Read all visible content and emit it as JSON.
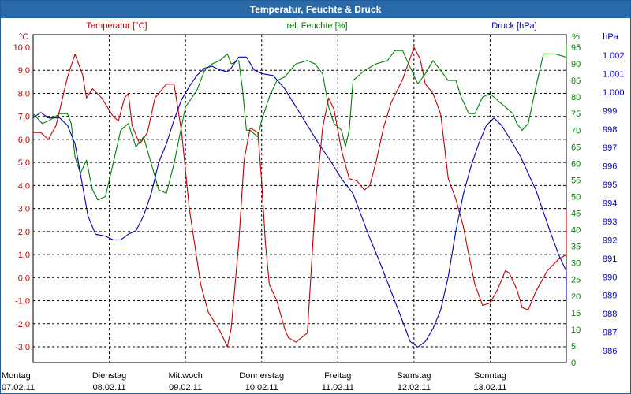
{
  "title": "Temperatur, Feuchte & Druck",
  "colors": {
    "temperature": "#c00000",
    "humidity": "#008000",
    "pressure": "#0000b4",
    "titlebar": "#2a6aa8",
    "grid": "#000000"
  },
  "chart_data": {
    "type": "line",
    "title": "Temperatur, Feuchte & Druck",
    "x_labels": [
      {
        "day": "Montag",
        "date": "07.02.11"
      },
      {
        "day": "Dienstag",
        "date": "08.02.11"
      },
      {
        "day": "Mittwoch",
        "date": "09.02.11"
      },
      {
        "day": "Donnerstag",
        "date": "10.02.11"
      },
      {
        "day": "Freitag",
        "date": "11.02.11"
      },
      {
        "day": "Samstag",
        "date": "12.02.11"
      },
      {
        "day": "Sonntag",
        "date": "13.02.11"
      }
    ],
    "x_range_days": [
      0,
      7
    ],
    "grid": true,
    "axes": {
      "temperature": {
        "unit": "°C",
        "label": "Temperatur [°C]",
        "range": [
          -3.0,
          10.0
        ],
        "ticks": [
          "10,0",
          "9,0",
          "8,0",
          "7,0",
          "6,0",
          "5,0",
          "4,0",
          "3,0",
          "2,0",
          "1,0",
          "0,0",
          "-1,0",
          "-2,0",
          "-3,0"
        ]
      },
      "humidity": {
        "unit": "%",
        "label": "rel. Feuchte [%]",
        "range": [
          0,
          95
        ],
        "ticks": [
          "95",
          "90",
          "85",
          "80",
          "75",
          "70",
          "65",
          "60",
          "55",
          "50",
          "45",
          "40",
          "35",
          "30",
          "25",
          "20",
          "15",
          "10",
          "5",
          "0"
        ]
      },
      "pressure": {
        "unit": "hPa",
        "label": "Druck [hPa]",
        "range": [
          986,
          1002
        ],
        "ticks": [
          "1.002",
          "1.001",
          "1.000",
          "999",
          "998",
          "997",
          "996",
          "995",
          "994",
          "993",
          "992",
          "991",
          "990",
          "989",
          "988",
          "987",
          "986"
        ]
      }
    },
    "series": [
      {
        "name": "Temperatur [°C]",
        "axis": "temperature",
        "points": [
          [
            0,
            6.3
          ],
          [
            0.1,
            6.3
          ],
          [
            0.2,
            6.0
          ],
          [
            0.3,
            6.6
          ],
          [
            0.45,
            8.7
          ],
          [
            0.55,
            9.7
          ],
          [
            0.65,
            8.8
          ],
          [
            0.7,
            7.8
          ],
          [
            0.78,
            8.2
          ],
          [
            0.9,
            7.8
          ],
          [
            1.05,
            7.0
          ],
          [
            1.12,
            6.8
          ],
          [
            1.2,
            7.8
          ],
          [
            1.25,
            8.0
          ],
          [
            1.3,
            6.6
          ],
          [
            1.4,
            5.8
          ],
          [
            1.5,
            6.3
          ],
          [
            1.6,
            7.8
          ],
          [
            1.75,
            8.4
          ],
          [
            1.85,
            8.4
          ],
          [
            1.95,
            6.3
          ],
          [
            2.05,
            3.0
          ],
          [
            2.2,
            -0.3
          ],
          [
            2.3,
            -1.5
          ],
          [
            2.45,
            -2.3
          ],
          [
            2.55,
            -3.0
          ],
          [
            2.6,
            -2.2
          ],
          [
            2.7,
            1.5
          ],
          [
            2.77,
            5.1
          ],
          [
            2.85,
            6.5
          ],
          [
            2.95,
            6.3
          ],
          [
            3.0,
            4.2
          ],
          [
            3.05,
            1.5
          ],
          [
            3.1,
            -0.3
          ],
          [
            3.2,
            -1.0
          ],
          [
            3.3,
            -2.2
          ],
          [
            3.35,
            -2.6
          ],
          [
            3.45,
            -2.8
          ],
          [
            3.6,
            -2.4
          ],
          [
            3.7,
            3.0
          ],
          [
            3.8,
            6.5
          ],
          [
            3.88,
            7.8
          ],
          [
            3.95,
            7.3
          ],
          [
            4.05,
            5.5
          ],
          [
            4.15,
            4.3
          ],
          [
            4.25,
            4.2
          ],
          [
            4.35,
            3.8
          ],
          [
            4.42,
            4.0
          ],
          [
            4.5,
            5.0
          ],
          [
            4.6,
            6.5
          ],
          [
            4.7,
            7.6
          ],
          [
            4.85,
            8.6
          ],
          [
            5.0,
            10.0
          ],
          [
            5.08,
            9.5
          ],
          [
            5.15,
            8.4
          ],
          [
            5.25,
            8.0
          ],
          [
            5.35,
            7.1
          ],
          [
            5.45,
            4.3
          ],
          [
            5.55,
            3.4
          ],
          [
            5.65,
            2.2
          ],
          [
            5.7,
            1.3
          ],
          [
            5.75,
            0.5
          ],
          [
            5.8,
            -0.3
          ],
          [
            5.9,
            -1.2
          ],
          [
            6.0,
            -1.1
          ],
          [
            6.1,
            -0.5
          ],
          [
            6.2,
            0.3
          ],
          [
            6.25,
            0.2
          ],
          [
            6.35,
            -0.5
          ],
          [
            6.42,
            -1.3
          ],
          [
            6.5,
            -1.4
          ],
          [
            6.6,
            -0.6
          ],
          [
            6.75,
            0.3
          ],
          [
            6.9,
            0.8
          ],
          [
            7.0,
            1.0
          ],
          [
            7.12,
            1.8
          ],
          [
            7.2,
            2.8
          ],
          [
            7.35,
            2.9
          ],
          [
            7.42,
            2.2
          ],
          [
            7.5,
            2.5
          ],
          [
            7.6,
            2.5
          ]
        ]
      },
      {
        "name": "rel. Feuchte [%]",
        "axis": "humidity",
        "points": [
          [
            0,
            75
          ],
          [
            0.12,
            72
          ],
          [
            0.22,
            73
          ],
          [
            0.35,
            75
          ],
          [
            0.45,
            75
          ],
          [
            0.5,
            72
          ],
          [
            0.55,
            62
          ],
          [
            0.62,
            57
          ],
          [
            0.7,
            61
          ],
          [
            0.78,
            52
          ],
          [
            0.85,
            49
          ],
          [
            0.95,
            50
          ],
          [
            1.05,
            60
          ],
          [
            1.15,
            70
          ],
          [
            1.25,
            72
          ],
          [
            1.35,
            65
          ],
          [
            1.45,
            68
          ],
          [
            1.55,
            60
          ],
          [
            1.65,
            52
          ],
          [
            1.75,
            51
          ],
          [
            1.85,
            60
          ],
          [
            2.0,
            77
          ],
          [
            2.15,
            82
          ],
          [
            2.25,
            88
          ],
          [
            2.35,
            90
          ],
          [
            2.45,
            91
          ],
          [
            2.55,
            93
          ],
          [
            2.6,
            90
          ],
          [
            2.7,
            91
          ],
          [
            2.75,
            82
          ],
          [
            2.8,
            70
          ],
          [
            2.85,
            70
          ],
          [
            2.95,
            68
          ],
          [
            3.0,
            73
          ],
          [
            3.1,
            80
          ],
          [
            3.2,
            85
          ],
          [
            3.3,
            86
          ],
          [
            3.45,
            90
          ],
          [
            3.6,
            91
          ],
          [
            3.7,
            90
          ],
          [
            3.8,
            87
          ],
          [
            3.88,
            77
          ],
          [
            3.95,
            72
          ],
          [
            4.05,
            70
          ],
          [
            4.1,
            65
          ],
          [
            4.15,
            70
          ],
          [
            4.2,
            85
          ],
          [
            4.35,
            88
          ],
          [
            4.5,
            90
          ],
          [
            4.65,
            91
          ],
          [
            4.75,
            94
          ],
          [
            4.85,
            94
          ],
          [
            4.95,
            89
          ],
          [
            5.05,
            84
          ],
          [
            5.15,
            87
          ],
          [
            5.25,
            91
          ],
          [
            5.35,
            88
          ],
          [
            5.45,
            85
          ],
          [
            5.55,
            85
          ],
          [
            5.62,
            80
          ],
          [
            5.72,
            75
          ],
          [
            5.8,
            75
          ],
          [
            5.9,
            80
          ],
          [
            6.0,
            81
          ],
          [
            6.1,
            79
          ],
          [
            6.2,
            77
          ],
          [
            6.3,
            75
          ],
          [
            6.35,
            72
          ],
          [
            6.42,
            70
          ],
          [
            6.5,
            72
          ],
          [
            6.6,
            83
          ],
          [
            6.7,
            93
          ],
          [
            6.85,
            93
          ],
          [
            7.0,
            92
          ],
          [
            7.15,
            93
          ],
          [
            7.3,
            93
          ],
          [
            7.45,
            91
          ],
          [
            7.6,
            92
          ],
          [
            7.75,
            95
          ],
          [
            7.85,
            95
          ],
          [
            7.95,
            96
          ]
        ]
      },
      {
        "name": "Druck [hPa]",
        "axis": "pressure",
        "points": [
          [
            0,
            998.6
          ],
          [
            0.1,
            998.9
          ],
          [
            0.2,
            998.6
          ],
          [
            0.35,
            998.6
          ],
          [
            0.45,
            998.2
          ],
          [
            0.55,
            997.2
          ],
          [
            0.62,
            995.6
          ],
          [
            0.72,
            993.3
          ],
          [
            0.82,
            992.3
          ],
          [
            0.95,
            992.2
          ],
          [
            1.05,
            992.0
          ],
          [
            1.15,
            992.0
          ],
          [
            1.25,
            992.3
          ],
          [
            1.35,
            992.5
          ],
          [
            1.45,
            993.3
          ],
          [
            1.55,
            994.5
          ],
          [
            1.65,
            996.2
          ],
          [
            1.75,
            997.2
          ],
          [
            1.85,
            998.5
          ],
          [
            1.95,
            999.6
          ],
          [
            2.05,
            1000.3
          ],
          [
            2.15,
            1000.9
          ],
          [
            2.25,
            1001.3
          ],
          [
            2.35,
            1001.4
          ],
          [
            2.45,
            1001.2
          ],
          [
            2.55,
            1001.1
          ],
          [
            2.6,
            1001.3
          ],
          [
            2.7,
            1001.9
          ],
          [
            2.8,
            1001.9
          ],
          [
            2.9,
            1001.2
          ],
          [
            3.0,
            1001.0
          ],
          [
            3.15,
            1000.9
          ],
          [
            3.3,
            1000.2
          ],
          [
            3.45,
            999.2
          ],
          [
            3.6,
            998.2
          ],
          [
            3.75,
            997.2
          ],
          [
            3.9,
            996.3
          ],
          [
            4.05,
            995.3
          ],
          [
            4.2,
            994.5
          ],
          [
            4.3,
            993.4
          ],
          [
            4.4,
            992.3
          ],
          [
            4.55,
            990.8
          ],
          [
            4.7,
            989.2
          ],
          [
            4.85,
            987.6
          ],
          [
            4.95,
            986.5
          ],
          [
            5.05,
            986.2
          ],
          [
            5.15,
            986.5
          ],
          [
            5.25,
            987.2
          ],
          [
            5.35,
            988.2
          ],
          [
            5.45,
            990.0
          ],
          [
            5.55,
            992.5
          ],
          [
            5.65,
            994.5
          ],
          [
            5.75,
            996.0
          ],
          [
            5.85,
            997.2
          ],
          [
            5.95,
            998.2
          ],
          [
            6.05,
            998.6
          ],
          [
            6.15,
            998.2
          ],
          [
            6.3,
            997.2
          ],
          [
            6.4,
            996.5
          ],
          [
            6.5,
            995.6
          ],
          [
            6.6,
            994.7
          ],
          [
            6.7,
            993.5
          ],
          [
            6.8,
            992.3
          ],
          [
            6.9,
            991.2
          ],
          [
            7.0,
            990.3
          ],
          [
            7.1,
            990.2
          ],
          [
            7.2,
            990.0
          ],
          [
            7.3,
            989.7
          ],
          [
            7.4,
            989.3
          ],
          [
            7.5,
            988.9
          ],
          [
            7.65,
            988.8
          ],
          [
            7.8,
            988.8
          ],
          [
            7.95,
            988.8
          ]
        ]
      }
    ]
  }
}
